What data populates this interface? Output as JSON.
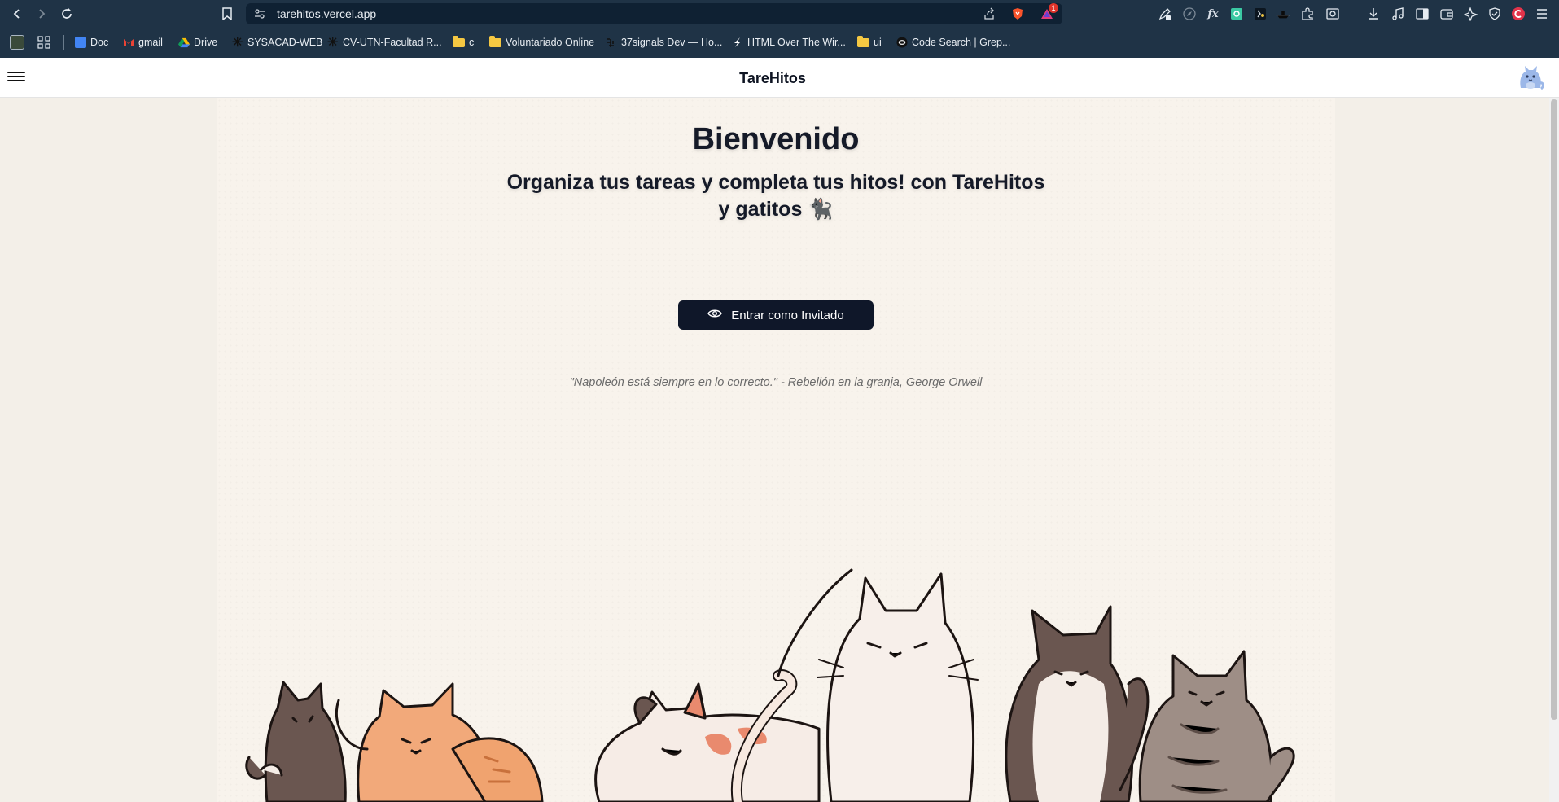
{
  "browser": {
    "url": "tarehitos.vercel.app",
    "shield_badge": "1",
    "extensions": [
      "pen-icon",
      "compass-icon",
      "fx-icon",
      "green-ext-icon",
      "dark-ext-icon",
      "boat-icon",
      "puzzle-icon",
      "screenshot-icon",
      "download-icon",
      "music-icon",
      "sidebar-icon",
      "wallet-icon",
      "sparkle-icon",
      "vpn-icon",
      "profile-icon",
      "menu-icon"
    ],
    "bookmarks": [
      {
        "label": "Doc",
        "icon": "docs-icon",
        "color": "#4285f4"
      },
      {
        "label": "gmail",
        "icon": "gmail-icon",
        "color": "#ea4335"
      },
      {
        "label": "Drive",
        "icon": "drive-icon",
        "color": "#0f9d58"
      },
      {
        "label": "SYSACAD-WEB",
        "icon": "asterisk-icon",
        "color": "#111111"
      },
      {
        "label": "CV-UTN-Facultad R...",
        "icon": "asterisk-icon",
        "color": "#111111"
      },
      {
        "label": "c",
        "icon": "folder-icon",
        "color": "#f5c842"
      },
      {
        "label": "Voluntariado Online",
        "icon": "folder-icon",
        "color": "#f5c842"
      },
      {
        "label": "37signals Dev — Ho...",
        "icon": "37signals-icon",
        "color": "#111111"
      },
      {
        "label": "HTML Over The Wir...",
        "icon": "hotwire-icon",
        "color": "#ffffff"
      },
      {
        "label": "ui",
        "icon": "folder-icon",
        "color": "#f5c842"
      },
      {
        "label": "Code Search | Grep...",
        "icon": "grep-icon",
        "color": "#111111"
      }
    ]
  },
  "header": {
    "brand": "TareHitos"
  },
  "hero": {
    "title": "Bienvenido",
    "subtitle_part1": "Organiza tus tareas y completa tus hitos! con ",
    "subtitle_brand": "TareHitos",
    "subtitle_part2": " y gatitos ",
    "subtitle_emoji": "🐈‍⬛"
  },
  "guest_button": {
    "label": "Entrar como Invitado"
  },
  "quote": "\"Napoleón está siempre en lo correcto.\" - Rebelión en la granja, George Orwell",
  "colors": {
    "chrome": "#1f3346",
    "button": "#0f1729",
    "panel": "#f8f3ec",
    "page": "#f3efe8"
  }
}
